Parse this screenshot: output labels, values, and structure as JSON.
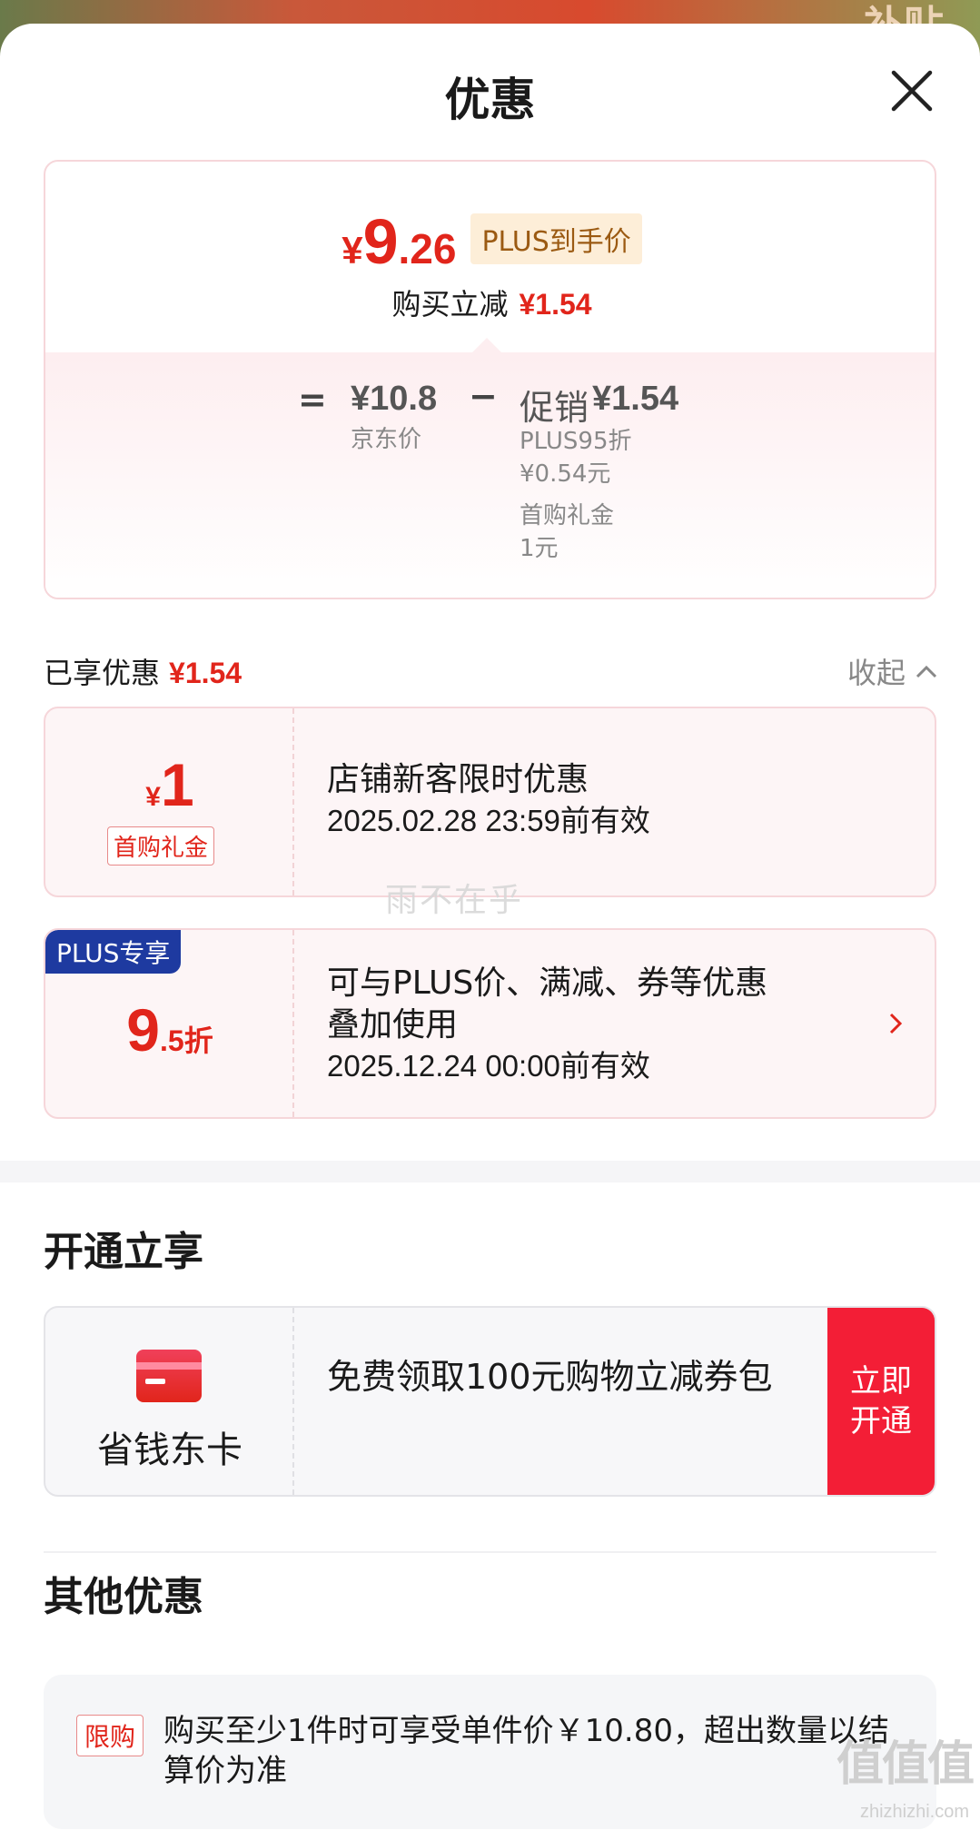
{
  "background": {
    "corner_text": "补贴"
  },
  "header": {
    "title": "优惠"
  },
  "price_card": {
    "final_price_yen": "¥",
    "final_price_int": "9",
    "final_price_dec": ".26",
    "plus_tag": "PLUS到手价",
    "reduce_label": "购买立减",
    "reduce_value": "¥1.54",
    "calc": {
      "equals": "=",
      "jd_price": "¥10.8",
      "jd_price_label": "京东价",
      "minus": "−",
      "promo_label": "促销",
      "promo_value": "¥1.54",
      "promo_items": [
        {
          "name": "PLUS95折",
          "value": "¥0.54元"
        },
        {
          "name": "首购礼金",
          "value": "1元"
        }
      ]
    }
  },
  "enjoyed": {
    "label": "已享优惠",
    "value": "¥1.54",
    "collapse_label": "收起"
  },
  "coupons": [
    {
      "amount_yen": "¥",
      "amount": "1",
      "tag": "首购礼金",
      "title": "店铺新客限时优惠",
      "date": "2025.02.28 23:59前有效"
    },
    {
      "corner": "PLUS专享",
      "amount_big": "9",
      "amount_small": ".5折",
      "title_line1": "可与PLUS价、满减、券等优惠",
      "title_line2": "叠加使用",
      "date": "2025.12.24 00:00前有效"
    }
  ],
  "open_section": {
    "title": "开通立享",
    "card_name": "省钱东卡",
    "desc": "免费领取100元购物立减券包",
    "button": "立即开通"
  },
  "other_section": {
    "title": "其他优惠",
    "tag": "限购",
    "text": "购买至少1件时可享受单件价￥10.80，超出数量以结算价为准"
  },
  "watermarks": {
    "center": "雨不在乎",
    "logo": "值值值",
    "url": "zhizhizhi.com"
  },
  "colors": {
    "accent_red": "#e1251b",
    "plus_blue": "#1e3aa0",
    "button_red": "#f31e36"
  }
}
